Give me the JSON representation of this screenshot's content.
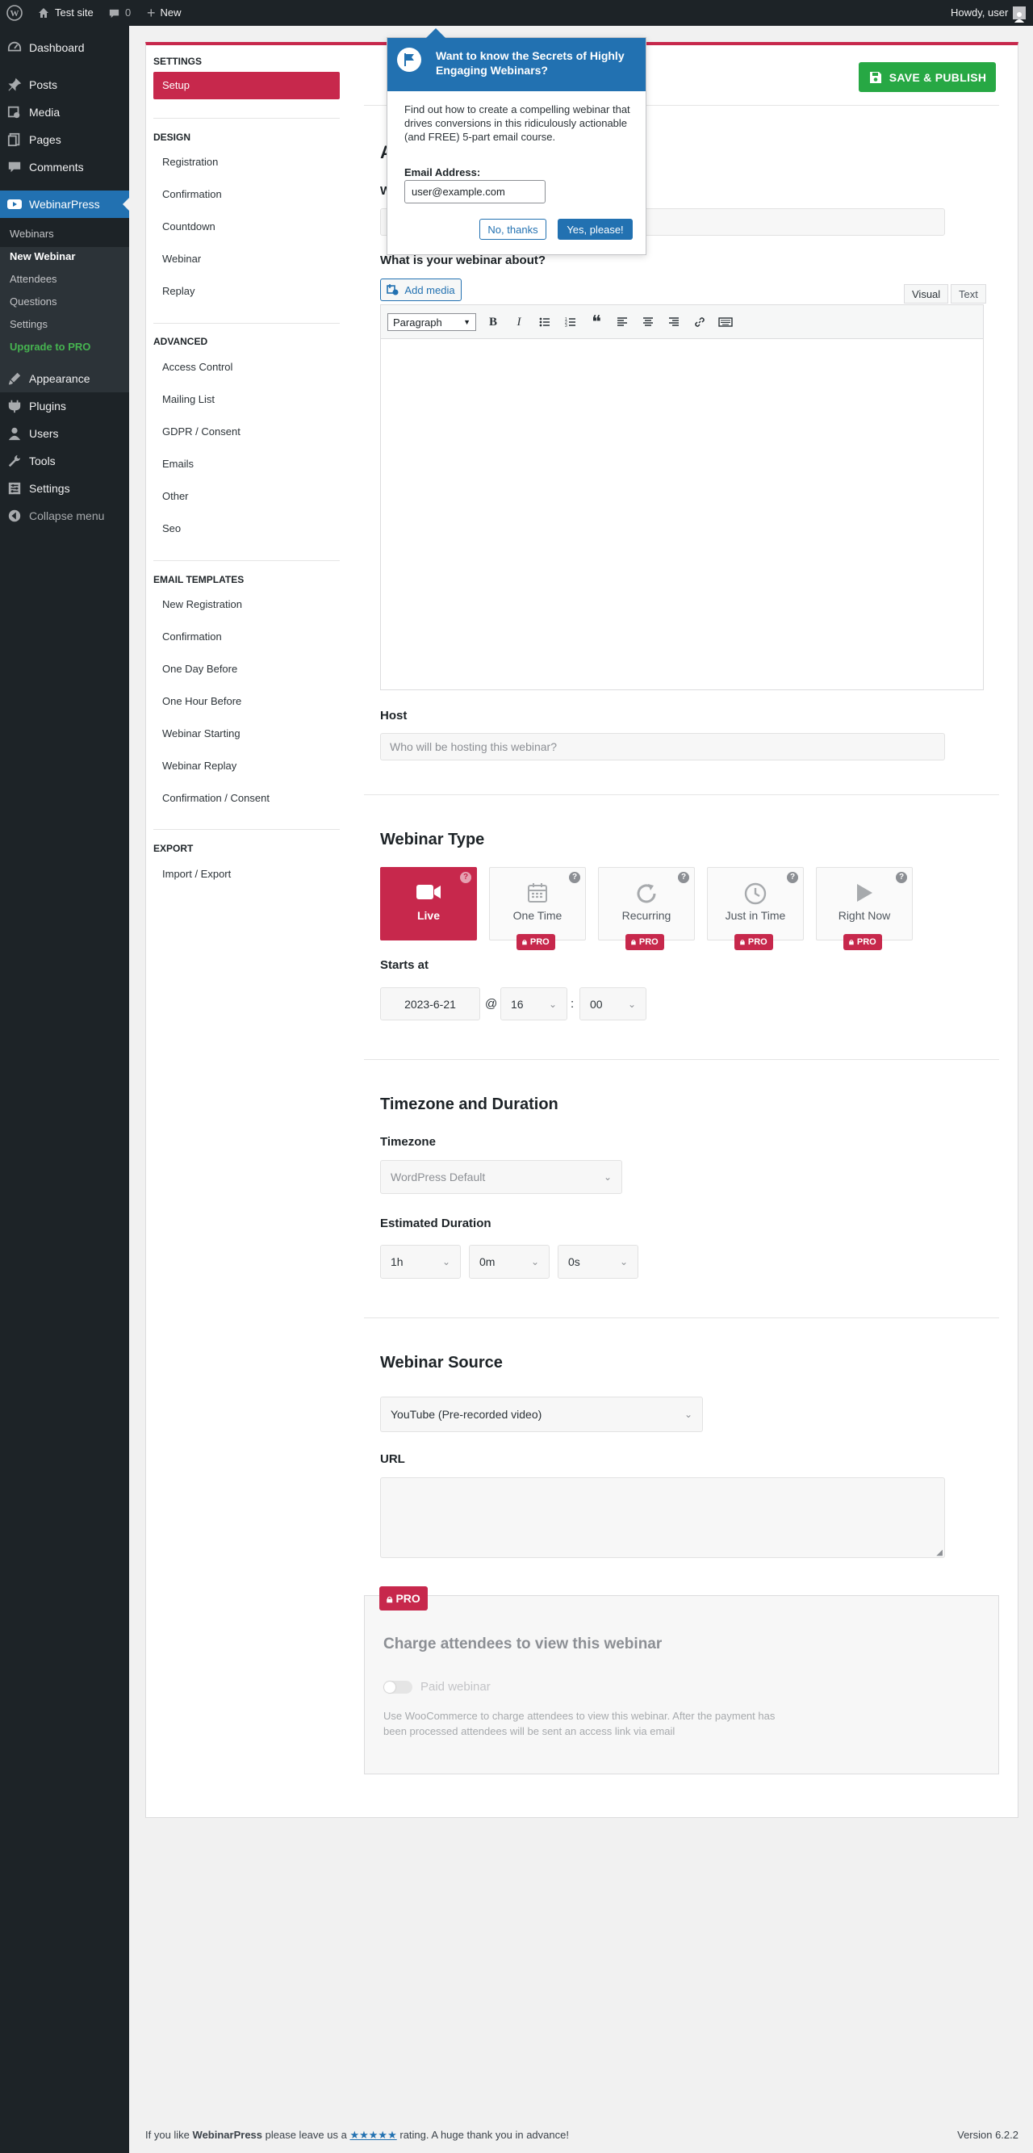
{
  "adminbar": {
    "site": "Test site",
    "comments": "0",
    "new": "New",
    "howdy": "Howdy, user"
  },
  "sidebar": {
    "items": [
      {
        "label": "Dashboard",
        "icon": "dashboard-icon"
      },
      {
        "label": "Posts",
        "icon": "pin-icon"
      },
      {
        "label": "Media",
        "icon": "media-icon"
      },
      {
        "label": "Pages",
        "icon": "pages-icon"
      },
      {
        "label": "Comments",
        "icon": "comment-icon"
      },
      {
        "label": "WebinarPress",
        "icon": "video-icon"
      },
      {
        "label": "Appearance",
        "icon": "brush-icon"
      },
      {
        "label": "Plugins",
        "icon": "plugin-icon"
      },
      {
        "label": "Users",
        "icon": "user-icon"
      },
      {
        "label": "Tools",
        "icon": "wrench-icon"
      },
      {
        "label": "Settings",
        "icon": "settings-icon"
      },
      {
        "label": "Collapse menu",
        "icon": "collapse-icon"
      }
    ],
    "submenu": [
      "Webinars",
      "New Webinar",
      "Attendees",
      "Questions",
      "Settings",
      "Upgrade to PRO"
    ]
  },
  "nav": {
    "settings_header": "SETTINGS",
    "setup": "Setup",
    "design_header": "DESIGN",
    "design": [
      "Registration",
      "Confirmation",
      "Countdown",
      "Webinar",
      "Replay"
    ],
    "advanced_header": "ADVANCED",
    "advanced": [
      "Access Control",
      "Mailing List",
      "GDPR / Consent",
      "Emails",
      "Other",
      "Seo"
    ],
    "email_header": "EMAIL TEMPLATES",
    "email": [
      "New Registration",
      "Confirmation",
      "One Day Before",
      "One Hour Before",
      "Webinar Starting",
      "Webinar Replay",
      "Confirmation / Consent"
    ],
    "export_header": "EXPORT",
    "export": [
      "Import / Export"
    ]
  },
  "toolbar": {
    "publish_label": "SAVE & PUBLISH"
  },
  "popup": {
    "title": "Want to know the Secrets of Highly Engaging Webinars?",
    "body": "Find out how to create a compelling webinar that drives conversions in this ridiculously actionable (and FREE) 5-part email course.",
    "email_label": "Email Address:",
    "email_value": "user@example.com",
    "no_label": "No, thanks",
    "yes_label": "Yes, please!"
  },
  "basic": {
    "about_label": "What is your webinar about?",
    "add_media": "Add media",
    "tab_visual": "Visual",
    "tab_text": "Text",
    "format": "Paragraph",
    "host_label": "Host",
    "host_placeholder": "Who will be hosting this webinar?"
  },
  "webinar_type": {
    "title": "Webinar Type",
    "types": [
      {
        "label": "Live",
        "selected": true,
        "pro": false
      },
      {
        "label": "One Time",
        "selected": false,
        "pro": true
      },
      {
        "label": "Recurring",
        "selected": false,
        "pro": true
      },
      {
        "label": "Just in Time",
        "selected": false,
        "pro": true
      },
      {
        "label": "Right Now",
        "selected": false,
        "pro": true
      }
    ],
    "pro_label": "PRO",
    "help": "?",
    "starts_label": "Starts at",
    "date": "2023-6-21",
    "at": "@",
    "hour": "16",
    "colon": ":",
    "minute": "00"
  },
  "timezone": {
    "title": "Timezone and Duration",
    "tz_label": "Timezone",
    "tz_value": "WordPress Default",
    "duration_label": "Estimated Duration",
    "hours": "1h",
    "minutes": "0m",
    "seconds": "0s"
  },
  "source": {
    "title": "Webinar Source",
    "value": "YouTube (Pre-recorded video)",
    "url_label": "URL"
  },
  "paid": {
    "badge": "PRO",
    "title": "Charge attendees to view this webinar",
    "toggle_label": "Paid webinar",
    "description": "Use WooCommerce to charge attendees to view this webinar. After the payment has been processed attendees will be sent an access link via email"
  },
  "footer": {
    "prefix": "If you like",
    "brand": "WebinarPress",
    "middle": "please leave us a",
    "stars": "★★★★★",
    "suffix": "rating. A huge thank you in advance!",
    "version": "Version 6.2.2"
  },
  "colors": {
    "accent": "#c7284c",
    "wp_blue": "#2271b1",
    "publish": "#27a844",
    "admin_dark": "#1d2327"
  }
}
